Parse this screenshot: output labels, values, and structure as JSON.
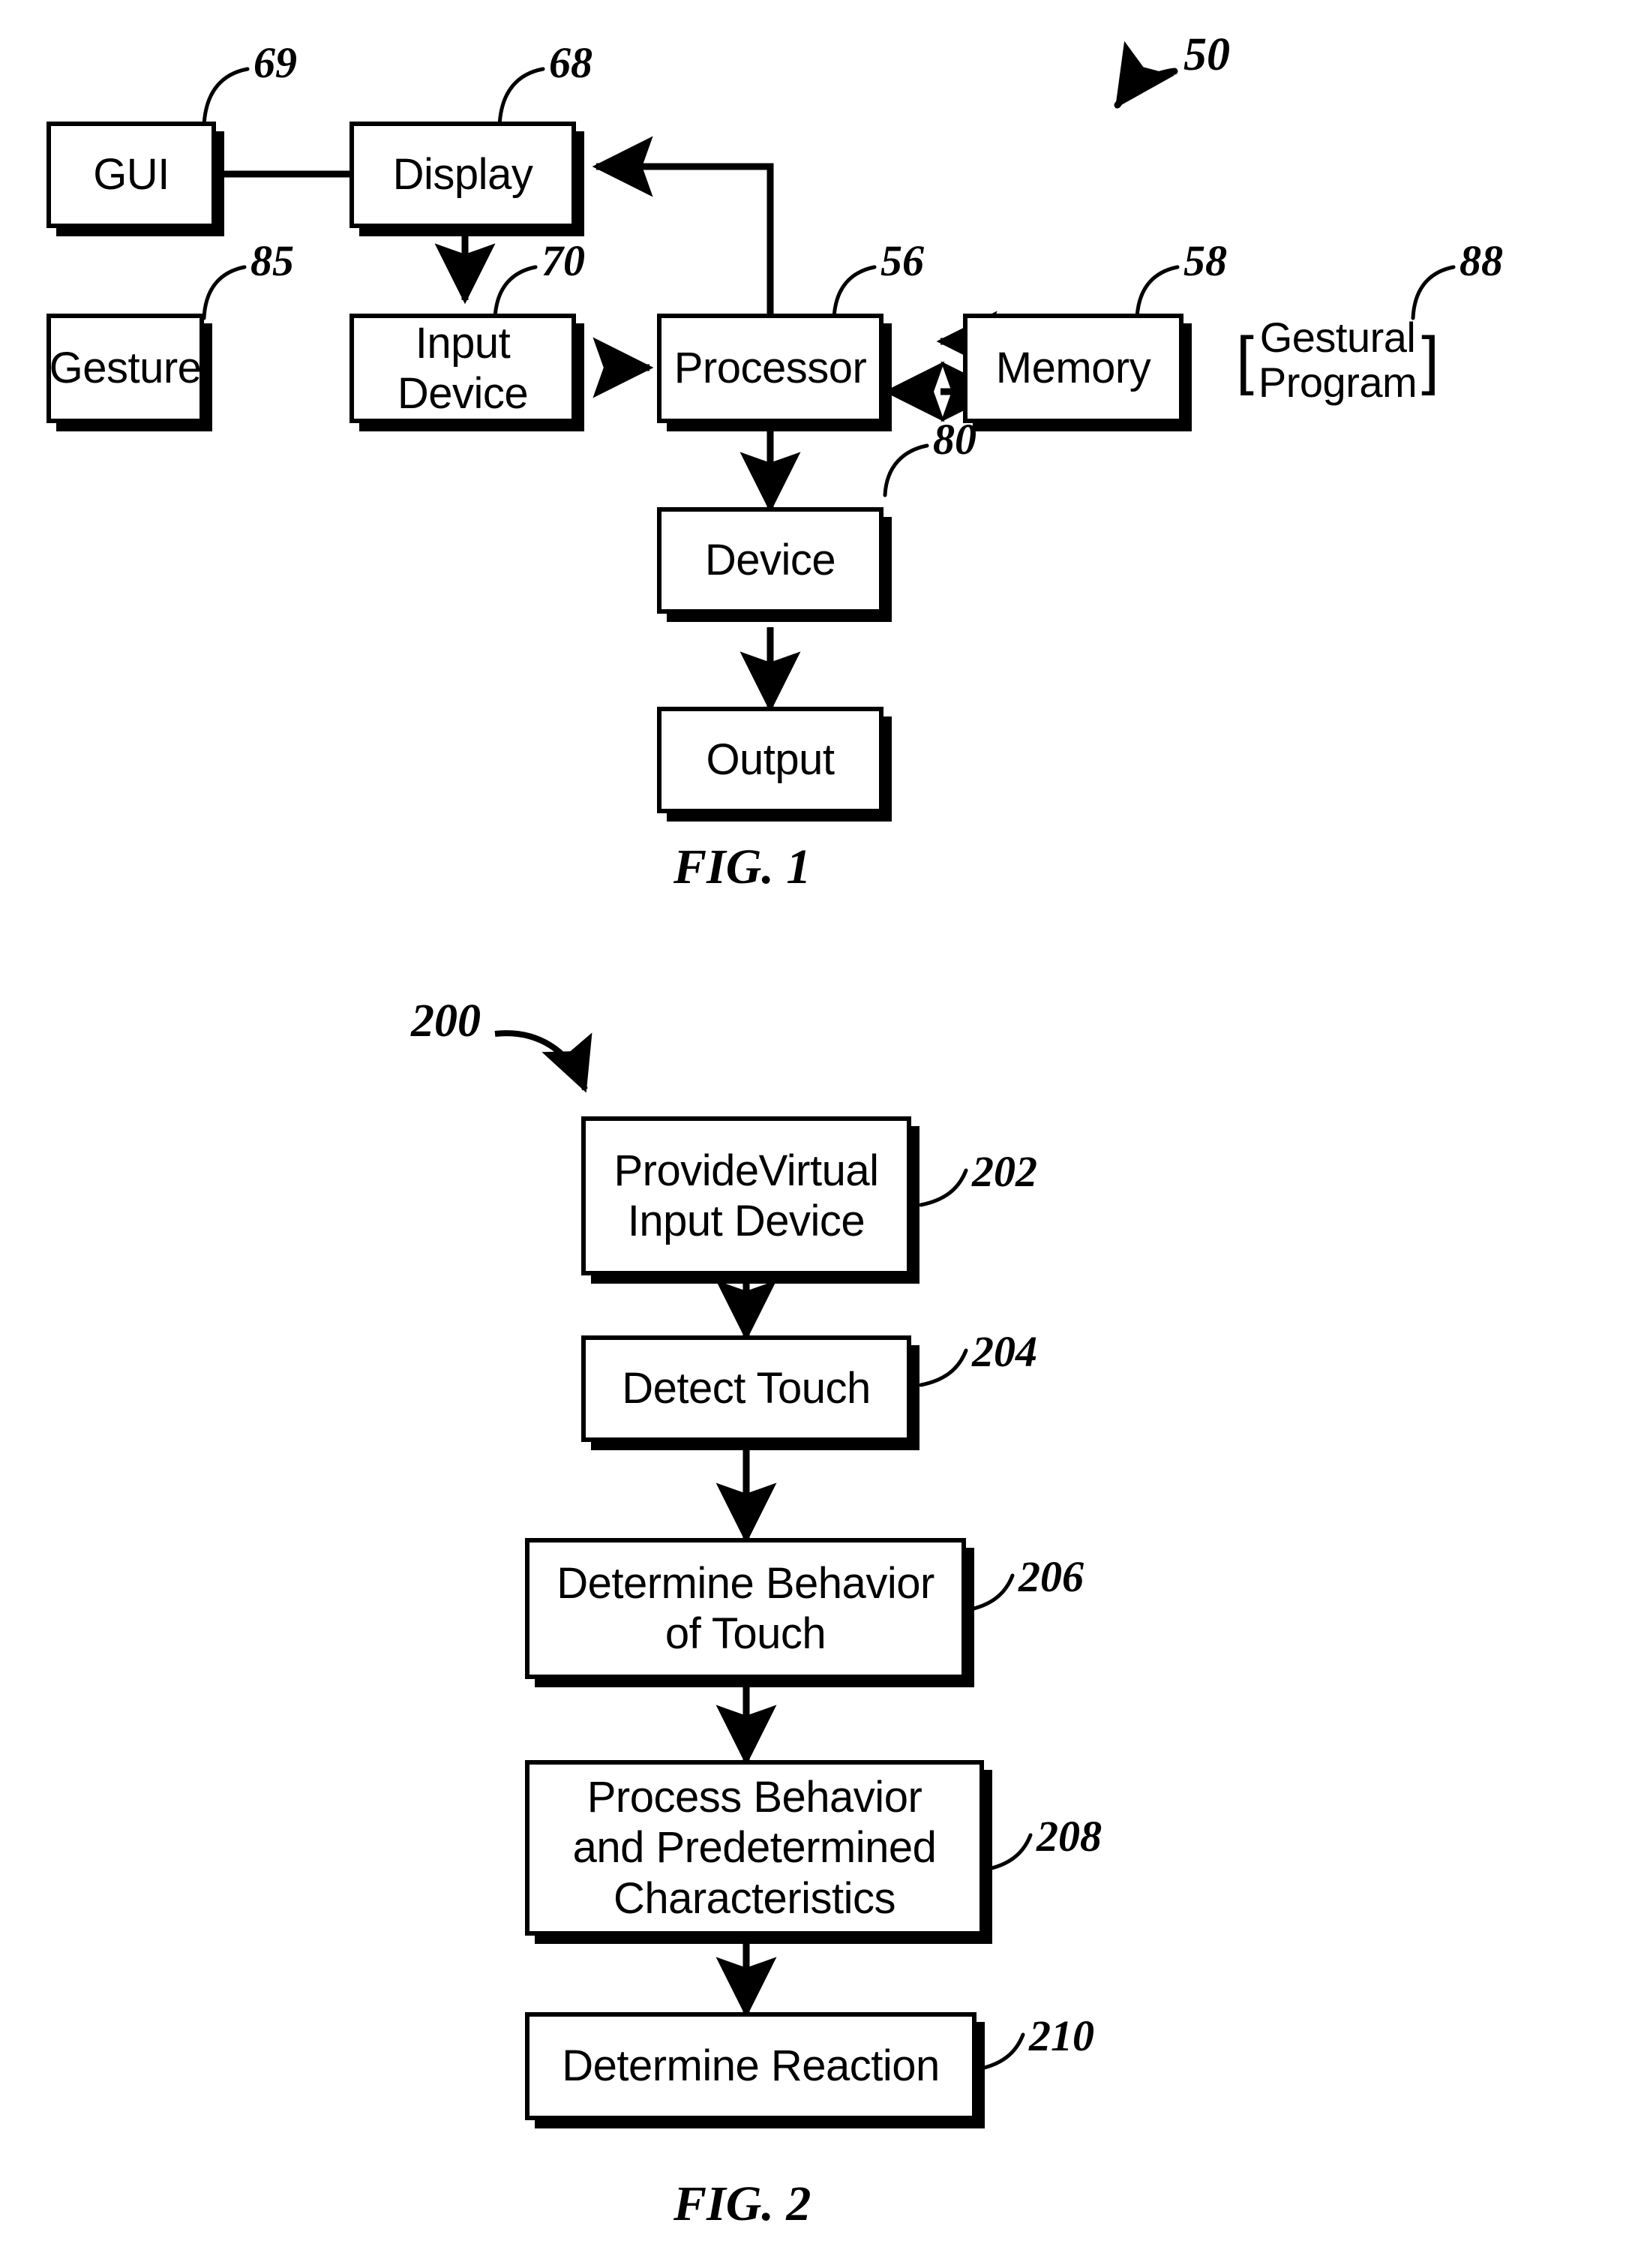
{
  "document": {
    "type": "patent-drawing-sheet",
    "figures": [
      "FIG. 1",
      "FIG. 2"
    ]
  },
  "fig1": {
    "caption": "FIG. 1",
    "system_numeral": "50",
    "blocks": [
      {
        "id": "gui",
        "label": "GUI",
        "numeral": "69"
      },
      {
        "id": "display",
        "label": "Display",
        "numeral": "68"
      },
      {
        "id": "gesture",
        "label": "Gesture",
        "numeral": "85"
      },
      {
        "id": "input_device",
        "label": "Input\nDevice",
        "numeral": "70"
      },
      {
        "id": "processor",
        "label": "Processor",
        "numeral": "56"
      },
      {
        "id": "memory",
        "label": "Memory",
        "numeral": "58"
      },
      {
        "id": "device",
        "label": "Device",
        "numeral": "80"
      },
      {
        "id": "output",
        "label": "Output",
        "numeral": null
      }
    ],
    "annotation": {
      "id": "gestural_program",
      "label": "Gestural\nProgram",
      "numeral": "88",
      "bracket_open": "[",
      "bracket_close": "]"
    },
    "connections": [
      {
        "from": "display",
        "to": "gui",
        "kind": "arrow"
      },
      {
        "from": "processor",
        "to": "display",
        "kind": "arrow-feedback"
      },
      {
        "from": "display",
        "to": "input_device",
        "kind": "arrow"
      },
      {
        "from": "gesture",
        "to": "input_device",
        "kind": "arrow"
      },
      {
        "from": "input_device",
        "to": "processor",
        "kind": "arrow"
      },
      {
        "from": "memory",
        "to": "processor",
        "kind": "arrow"
      },
      {
        "from": "processor",
        "to": "memory",
        "kind": "double-arrow"
      },
      {
        "from": "processor",
        "to": "device",
        "kind": "arrow"
      },
      {
        "from": "device",
        "to": "output",
        "kind": "arrow"
      }
    ]
  },
  "fig2": {
    "caption": "FIG. 2",
    "flow_numeral": "200",
    "steps": [
      {
        "id": "step_202",
        "label": "ProvideVirtual\nInput Device",
        "numeral": "202"
      },
      {
        "id": "step_204",
        "label": "Detect Touch",
        "numeral": "204"
      },
      {
        "id": "step_206",
        "label": "Determine Behavior\nof Touch",
        "numeral": "206"
      },
      {
        "id": "step_208",
        "label": "Process Behavior\nand Predetermined\nCharacteristics",
        "numeral": "208"
      },
      {
        "id": "step_210",
        "label": "Determine Reaction",
        "numeral": "210"
      }
    ],
    "connections": [
      {
        "from": "step_202",
        "to": "step_204",
        "kind": "arrow"
      },
      {
        "from": "step_204",
        "to": "step_206",
        "kind": "arrow"
      },
      {
        "from": "step_206",
        "to": "step_208",
        "kind": "arrow"
      },
      {
        "from": "step_208",
        "to": "step_210",
        "kind": "arrow"
      }
    ]
  },
  "colors": {
    "ink": "#000000",
    "paper": "#ffffff"
  }
}
